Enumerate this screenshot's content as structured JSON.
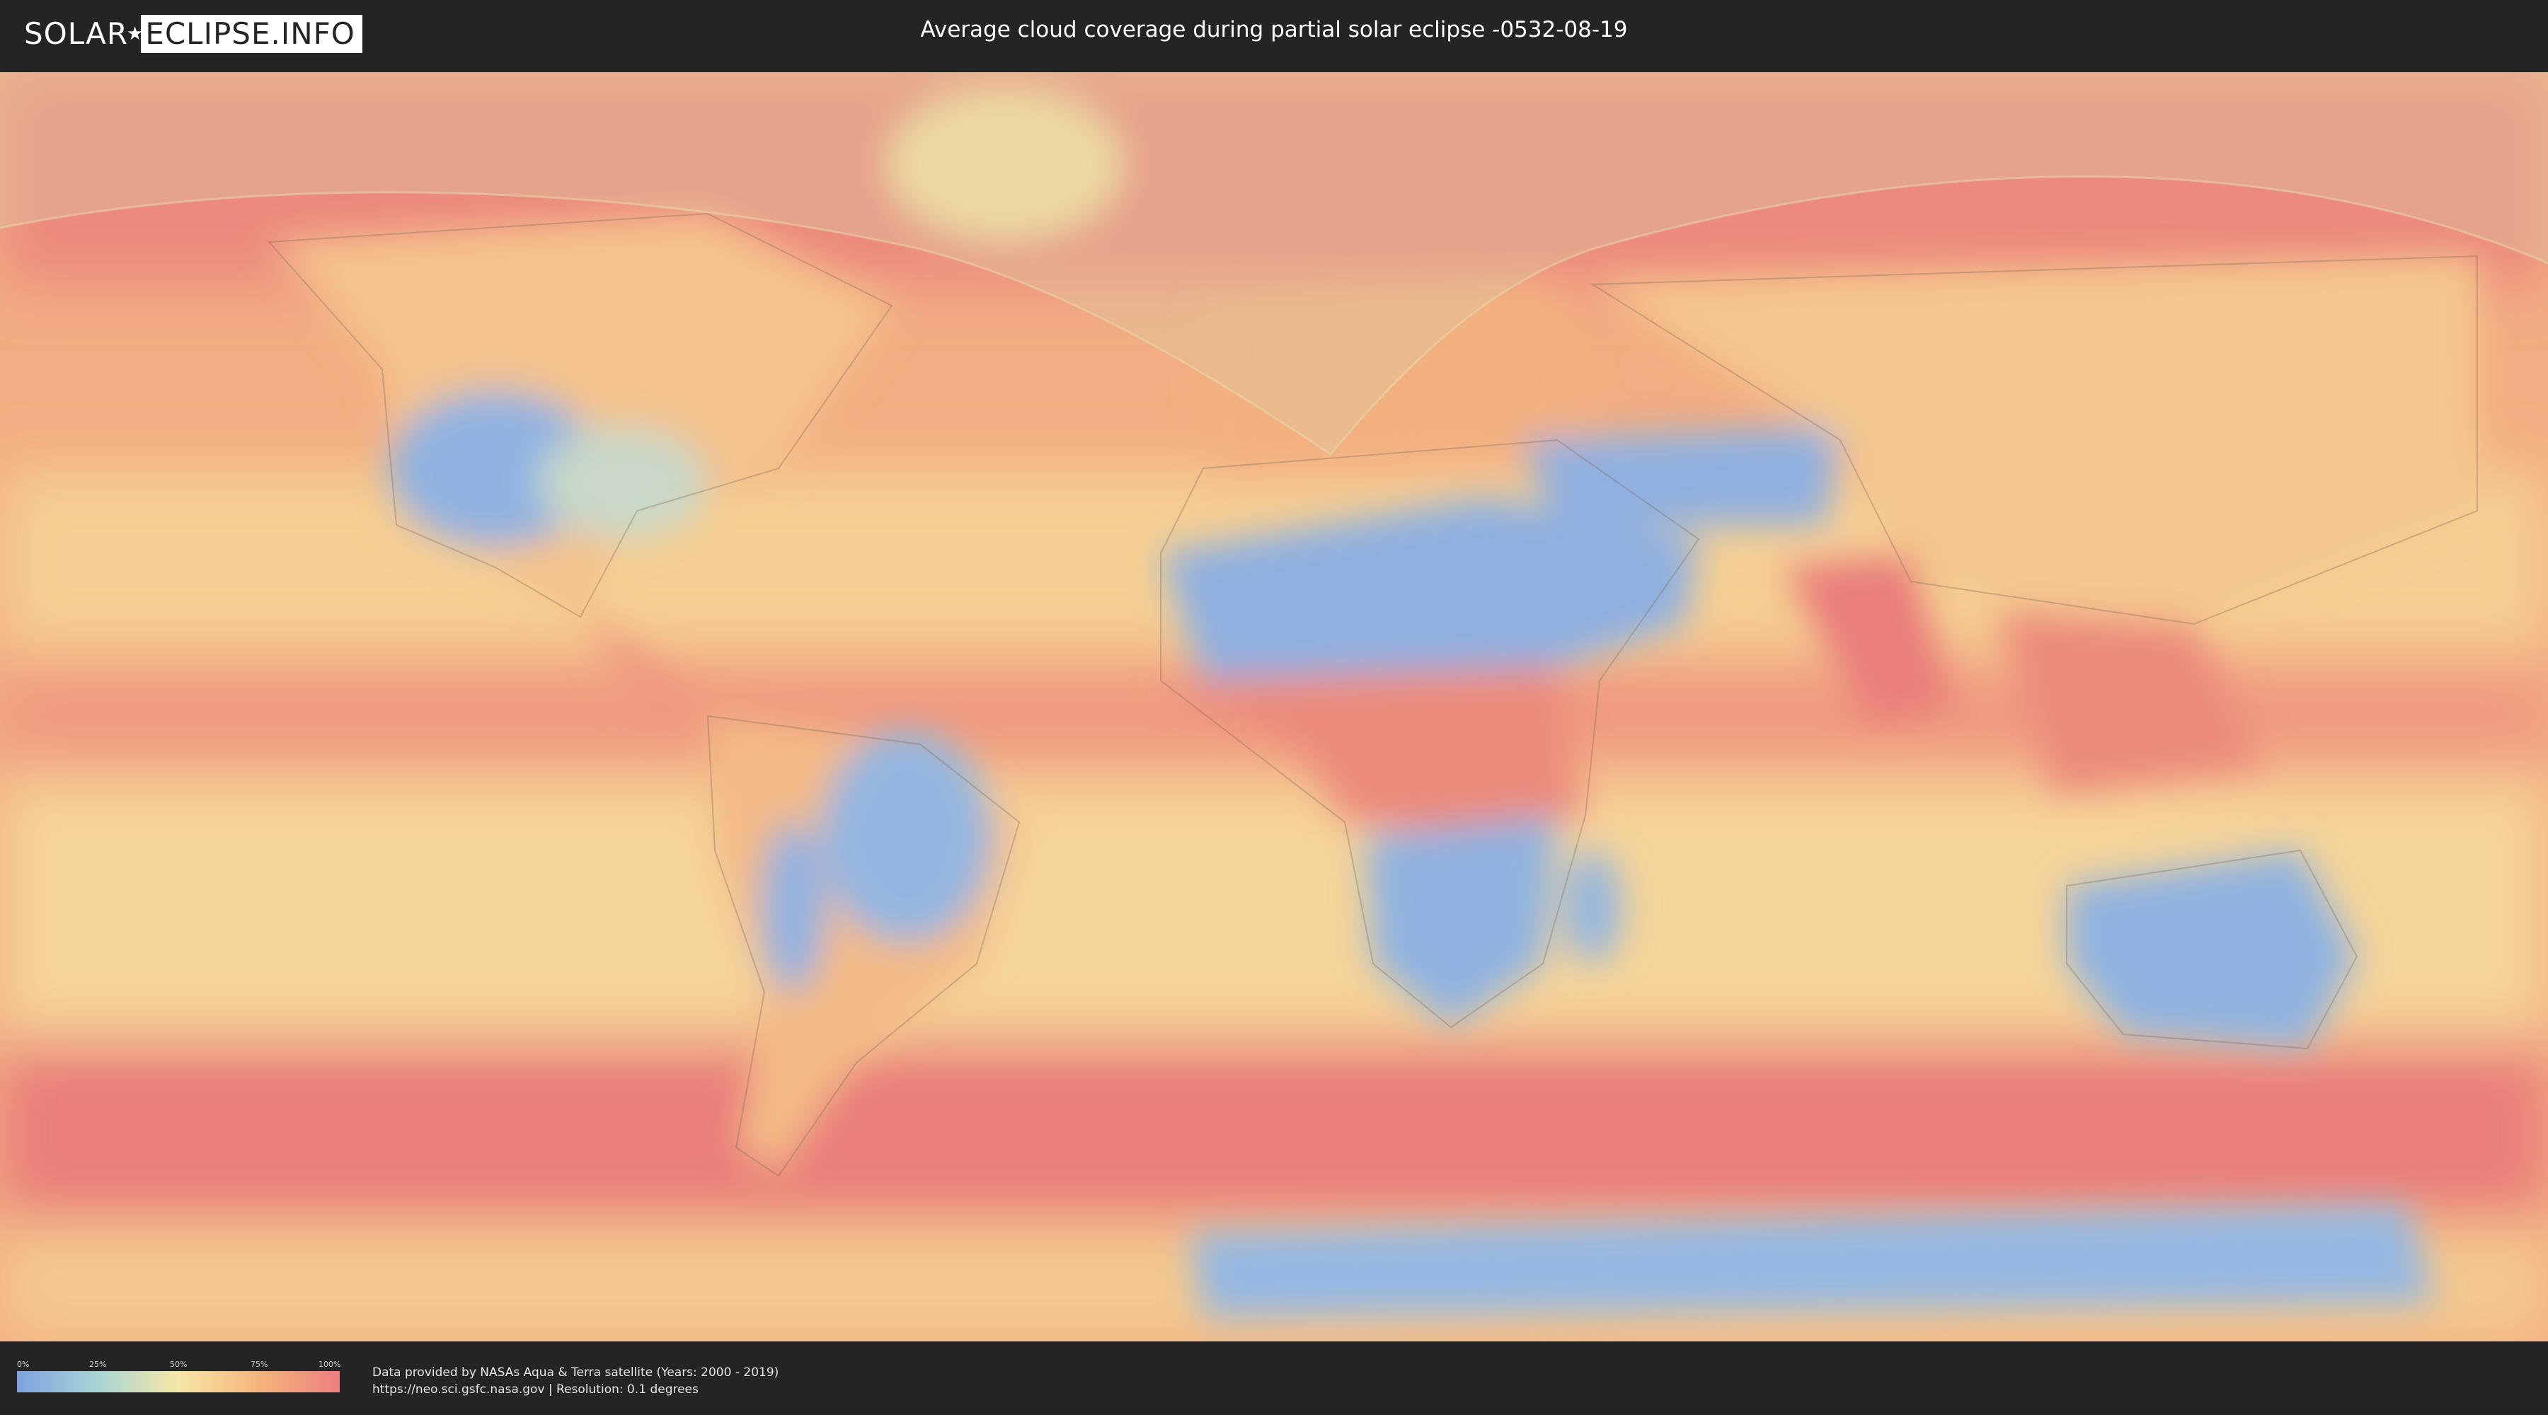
{
  "header": {
    "logo_left": "SOLAR",
    "logo_right": "ECLIPSE.INFO",
    "title": "Average cloud coverage during partial solar eclipse -0532-08-19"
  },
  "legend": {
    "ticks": [
      "0%",
      "25%",
      "50%",
      "75%",
      "100%"
    ],
    "colors": [
      "#7ea3e0",
      "#a8d5d5",
      "#f6e7a6",
      "#f4b47a",
      "#ec7f7f"
    ]
  },
  "footer": {
    "credit_line1": "Data provided by NASAs Aqua & Terra satellite (Years: 2000 - 2019)",
    "credit_line2": "https://neo.sci.gsfc.nasa.gov | Resolution: 0.1 degrees"
  },
  "map": {
    "projection": "equirectangular world map",
    "overlay": "eclipse visibility zone (northern hemisphere shading)",
    "colors": {
      "clear": "#7ea3e0",
      "mid": "#f6e7a6",
      "cloudy": "#ec7f7f"
    }
  }
}
